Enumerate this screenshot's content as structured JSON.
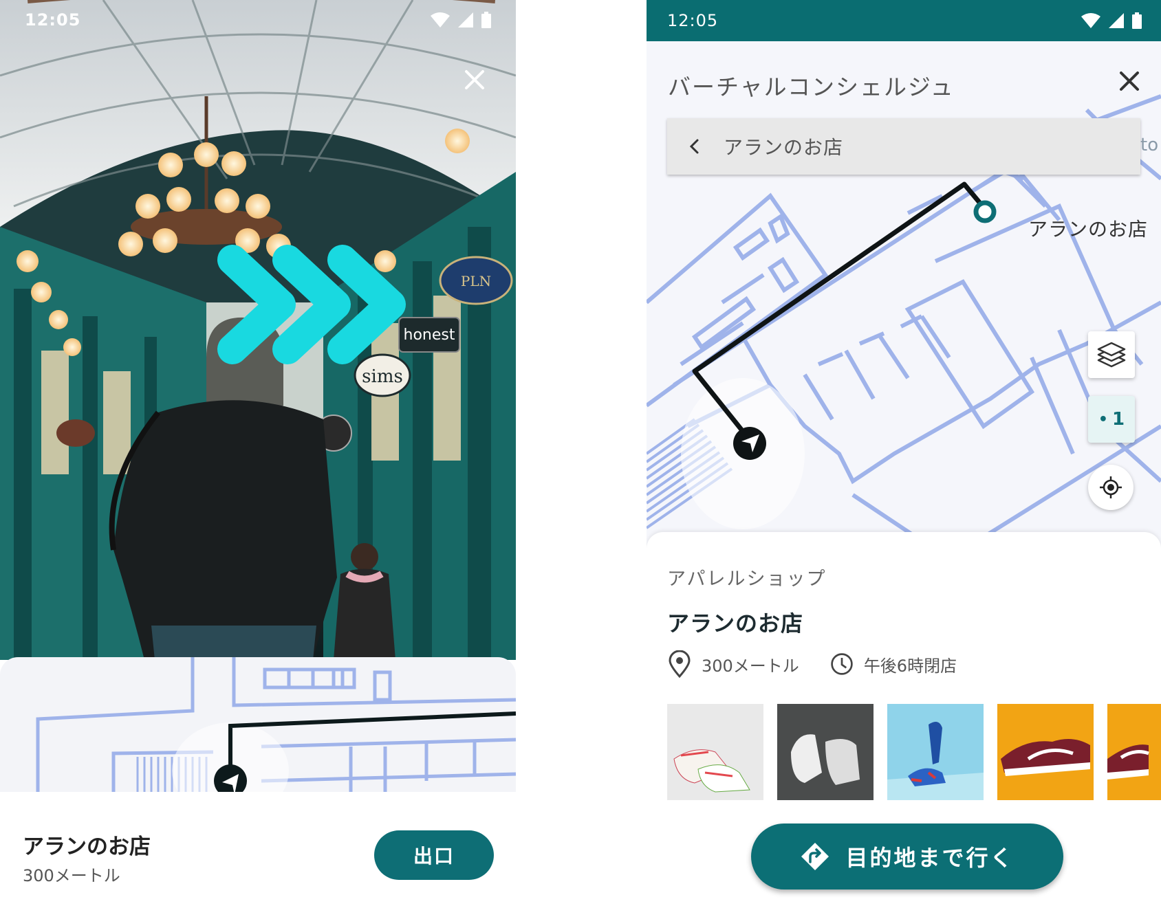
{
  "left_screen": {
    "status": {
      "time": "12:05"
    },
    "ar_signs": {
      "honest": "honest",
      "sims": "sims"
    },
    "destination": {
      "name": "アランのお店",
      "distance": "300メートル"
    },
    "exit_button": "出口"
  },
  "right_screen": {
    "status": {
      "time": "12:05"
    },
    "header_title": "バーチャルコンシェルジュ",
    "search": {
      "value": "アランのお店",
      "overflow": "to"
    },
    "map": {
      "destination_label": "アランのお店",
      "floor": "1"
    },
    "place": {
      "category": "アパレルショップ",
      "name": "アランのお店",
      "distance": "300メートル",
      "hours": "午後6時閉店"
    },
    "go_button": "目的地まで行く"
  },
  "colors": {
    "teal": "#0e6e75",
    "status_teal": "#0a6d71",
    "ar_chevron": "#19d9e0",
    "map_lines": "#9fb3ea"
  }
}
